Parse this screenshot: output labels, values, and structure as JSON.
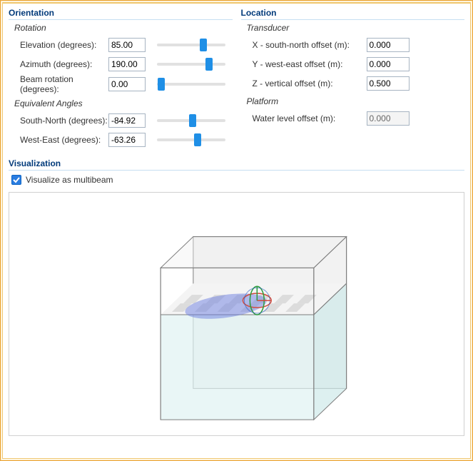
{
  "orientation": {
    "header": "Orientation",
    "rotation_label": "Rotation",
    "equivalent_label": "Equivalent Angles",
    "elevation": {
      "label": "Elevation (degrees):",
      "value": "85.00",
      "pct": 68
    },
    "azimuth": {
      "label": "Azimuth (degrees):",
      "value": "190.00",
      "pct": 76
    },
    "beam": {
      "label": "Beam rotation (degrees):",
      "value": "0.00",
      "pct": 6
    },
    "sn": {
      "label": "South-North (degrees):",
      "value": "-84.92",
      "pct": 52
    },
    "we": {
      "label": "West-East (degrees):",
      "value": "-63.26",
      "pct": 60
    }
  },
  "location": {
    "header": "Location",
    "transducer_label": "Transducer",
    "platform_label": "Platform",
    "x": {
      "label": "X - south-north offset (m):",
      "value": "0.000"
    },
    "y": {
      "label": "Y - west-east offset (m):",
      "value": "0.000"
    },
    "z": {
      "label": "Z - vertical offset (m):",
      "value": "0.500"
    },
    "water": {
      "label": "Water level offset (m):",
      "value": "0.000",
      "readonly": true
    }
  },
  "visualization": {
    "header": "Visualization",
    "checkbox_label": "Visualize as multibeam",
    "checked": true
  }
}
